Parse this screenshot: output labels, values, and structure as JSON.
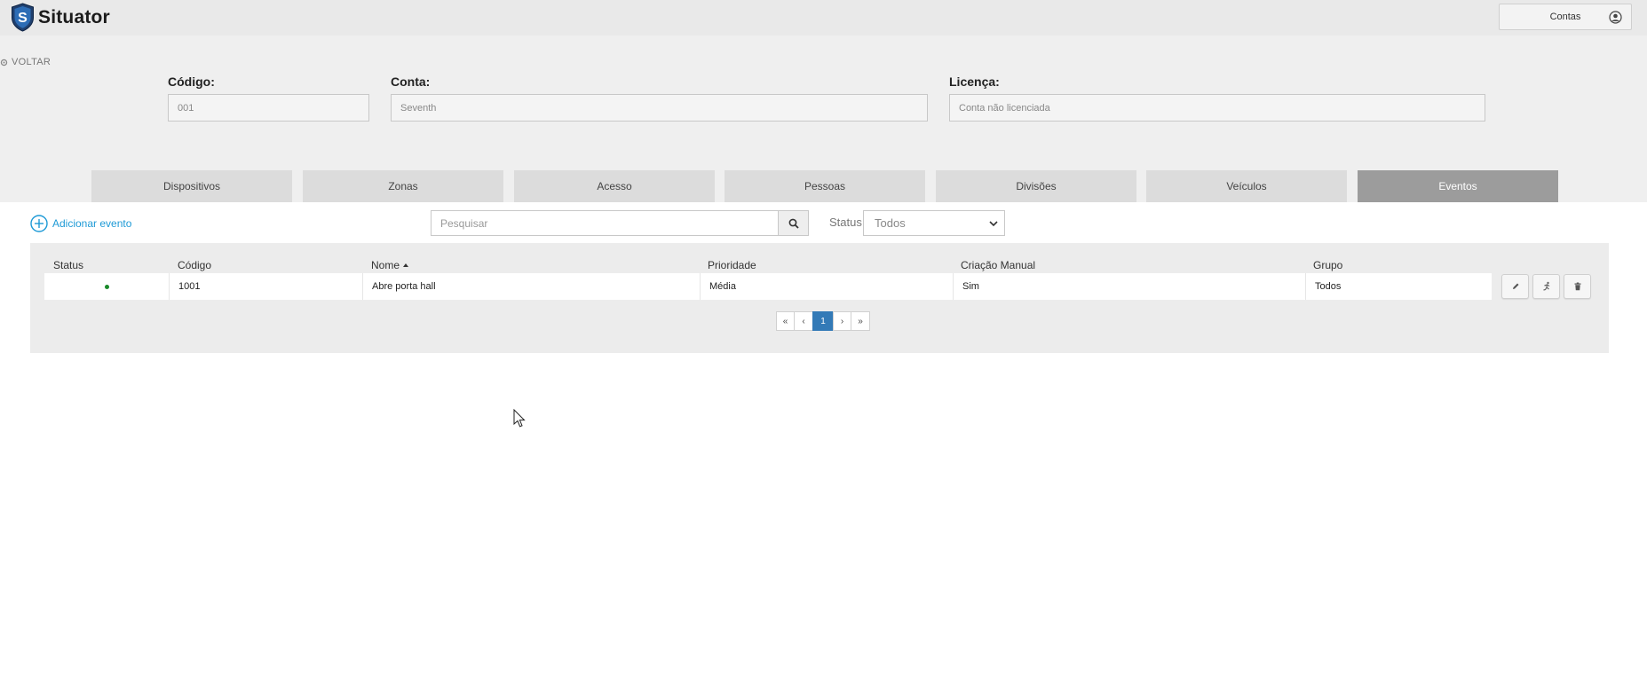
{
  "app": {
    "title": "Situator",
    "logo_letter": "S"
  },
  "header": {
    "accounts_label": "Contas"
  },
  "nav": {
    "back_label": "VOLTAR"
  },
  "account": {
    "code_label": "Código:",
    "code_value": "001",
    "account_label": "Conta:",
    "account_value": "Seventh",
    "license_label": "Licença:",
    "license_value": "Conta não licenciada"
  },
  "tabs": [
    {
      "label": "Dispositivos"
    },
    {
      "label": "Zonas"
    },
    {
      "label": "Acesso"
    },
    {
      "label": "Pessoas"
    },
    {
      "label": "Divisões"
    },
    {
      "label": "Veículos"
    },
    {
      "label": "Eventos",
      "active": true
    }
  ],
  "toolbar": {
    "add_label": "Adicionar evento",
    "search_placeholder": "Pesquisar",
    "status_label": "Status",
    "status_value": "Todos"
  },
  "table": {
    "headers": {
      "status": "Status",
      "code": "Código",
      "name": "Nome",
      "priority": "Prioridade",
      "manual": "Criação Manual",
      "group": "Grupo"
    },
    "sort_column": "Nome",
    "rows": [
      {
        "status_color": "#1a8a2a",
        "code": "1001",
        "name": "Abre porta hall",
        "priority": "Média",
        "manual": "Sim",
        "group": "Todos"
      }
    ]
  },
  "pagination": {
    "first": "«",
    "prev": "‹",
    "current": "1",
    "next": "›",
    "last": "»"
  },
  "icons": [
    "shield-logo-icon",
    "user-circle-icon",
    "gear-icon",
    "plus-circle-icon",
    "search-icon",
    "chevron-down-icon",
    "sort-asc-icon",
    "pencil-icon",
    "run-icon",
    "trash-icon"
  ],
  "colors": {
    "accent": "#1e9ad6",
    "active_tab": "#9c9c9c",
    "pagination_active": "#337ab7",
    "status_ok": "#1a8a2a"
  }
}
